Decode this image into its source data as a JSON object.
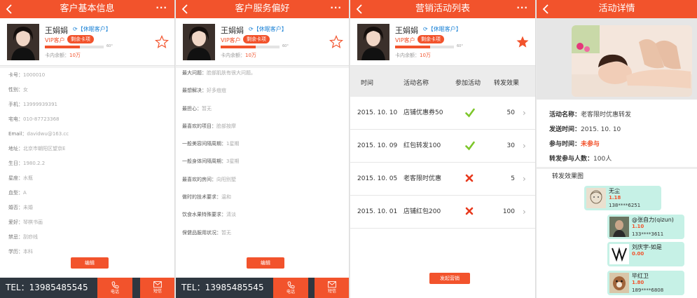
{
  "customer": {
    "name": "王娟娟",
    "tag": "【休眠客户】",
    "level": "VIP客户",
    "badge": "剩余卡项",
    "progress_percent": 60,
    "progress_text": "60°",
    "balance_label": "卡内余额：",
    "balance_value": "10万"
  },
  "screen1": {
    "title": "客户基本信息",
    "fields": [
      {
        "label": "卡号：",
        "value": "1000010"
      },
      {
        "label": "性别：",
        "value": "女"
      },
      {
        "label": "手机：",
        "value": "13999939391"
      },
      {
        "label": "宅电：",
        "value": "010-87723368"
      },
      {
        "label": "Email：",
        "value": "davidwu@163.cc"
      },
      {
        "label": "地址：",
        "value": "北京市朝阳区望京E"
      },
      {
        "label": "生日：",
        "value": "1980.2.2"
      },
      {
        "label": "星座：",
        "value": "水瓶"
      },
      {
        "label": "血型：",
        "value": "A"
      },
      {
        "label": "婚否：",
        "value": "未婚"
      },
      {
        "label": "爱好：",
        "value": "琴棋书画"
      },
      {
        "label": "禁忌：",
        "value": "刮痧线"
      },
      {
        "label": "学历：",
        "value": "本科"
      }
    ],
    "edit_label": "编辑",
    "tel": "TEL：13985485545",
    "call_label": "电话",
    "sms_label": "短信"
  },
  "screen2": {
    "title": "客户服务偏好",
    "fields": [
      {
        "label": "最大问题：",
        "value": "脸部肌肤有很大问题。"
      },
      {
        "label": "最想解决：",
        "value": "好多痘痘"
      },
      {
        "label": "最担心：",
        "value": "暂无"
      },
      {
        "label": "最喜欢的项目：",
        "value": "脸部按摩"
      },
      {
        "label": "一般美容间隔周期：",
        "value": "1星期"
      },
      {
        "label": "一般身体间隔周期：",
        "value": "3星期"
      },
      {
        "label": "最喜欢的房间：",
        "value": "向阳别墅"
      },
      {
        "label": "做时的技术要求：",
        "value": "温和"
      },
      {
        "label": "饮食水果特殊要求：",
        "value": "清淡"
      },
      {
        "label": "保健品服用状况：",
        "value": "暂无"
      }
    ],
    "edit_label": "编辑",
    "tel": "TEL：13985485545",
    "call_label": "电话",
    "sms_label": "短信"
  },
  "screen3": {
    "title": "营销活动列表",
    "columns": [
      "时间",
      "活动名称",
      "参加活动",
      "转发效果"
    ],
    "rows": [
      {
        "date": "2015. 10. 10",
        "name": "店铺优惠券50",
        "joined": true,
        "forwards": "50"
      },
      {
        "date": "2015. 10. 09",
        "name": "红包转发100",
        "joined": true,
        "forwards": "30"
      },
      {
        "date": "2015. 10. 05",
        "name": "老客限时优惠",
        "joined": false,
        "forwards": "5"
      },
      {
        "date": "2015. 10. 01",
        "name": "店铺红包200",
        "joined": false,
        "forwards": "100"
      }
    ],
    "launch_label": "发起营销"
  },
  "screen4": {
    "title": "活动详情",
    "details": [
      {
        "label": "活动名称：",
        "value": "老客限时优惠转发"
      },
      {
        "label": "发送时间：",
        "value": "2015. 10. 10"
      },
      {
        "label": "参与时间：",
        "value": "未参与"
      },
      {
        "label": "转发参与人数：",
        "value": "100人"
      }
    ],
    "forward_title": "转发效果图",
    "forwards": [
      {
        "name": "无尘",
        "value": "1.18",
        "phone": "138****6251"
      },
      {
        "name": "@张自力(qizun)",
        "value": "1.10",
        "phone": "133****3611"
      },
      {
        "name": "刘庆宇-如是",
        "value": "0.00",
        "phone": ""
      },
      {
        "name": "毕红卫",
        "value": "1.80",
        "phone": "189****6808"
      }
    ]
  },
  "colors": {
    "accent": "#f2532c",
    "link": "#1b82d6",
    "check": "#7dc62a",
    "card": "#c6f1e6",
    "dark": "#2f3740"
  }
}
